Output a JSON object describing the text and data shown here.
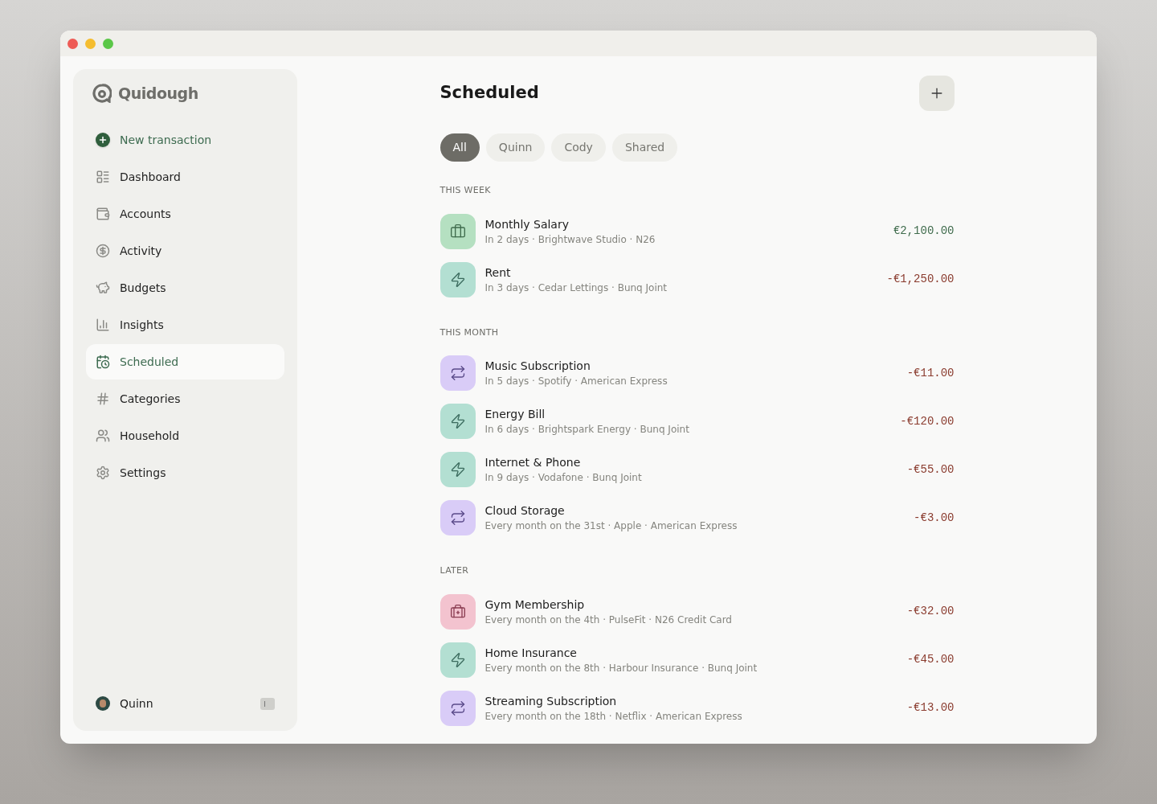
{
  "app": {
    "name": "Quidough"
  },
  "sidebar": {
    "items": [
      {
        "label": "New transaction",
        "kind": "action",
        "selected": false
      },
      {
        "label": "Dashboard",
        "kind": "dashboard",
        "selected": false
      },
      {
        "label": "Accounts",
        "kind": "wallet",
        "selected": false
      },
      {
        "label": "Activity",
        "kind": "coin",
        "selected": false
      },
      {
        "label": "Budgets",
        "kind": "piggy",
        "selected": false
      },
      {
        "label": "Insights",
        "kind": "chart",
        "selected": false
      },
      {
        "label": "Scheduled",
        "kind": "calendar",
        "selected": true
      },
      {
        "label": "Categories",
        "kind": "hash",
        "selected": false
      },
      {
        "label": "Household",
        "kind": "people",
        "selected": false
      },
      {
        "label": "Settings",
        "kind": "gear",
        "selected": false
      }
    ],
    "user": {
      "name": "Quinn"
    }
  },
  "page": {
    "title": "Scheduled"
  },
  "filters": [
    {
      "label": "All",
      "selected": true
    },
    {
      "label": "Quinn",
      "selected": false
    },
    {
      "label": "Cody",
      "selected": false
    },
    {
      "label": "Shared",
      "selected": false
    }
  ],
  "sections": [
    {
      "title": "THIS WEEK",
      "items": [
        {
          "name": "Monthly Salary",
          "detail": "In 2 days · Brightwave Studio · N26",
          "amount": "€2,100.00",
          "income": true,
          "kind": "briefcase",
          "color": "#b5e0c1"
        },
        {
          "name": "Rent",
          "detail": "In 3 days · Cedar Lettings · Bunq Joint",
          "amount": "-€1,250.00",
          "income": false,
          "kind": "bolt",
          "color": "#b3dfd2"
        }
      ]
    },
    {
      "title": "THIS MONTH",
      "items": [
        {
          "name": "Music Subscription",
          "detail": "In 5 days · Spotify · American Express",
          "amount": "-€11.00",
          "income": false,
          "kind": "repeat",
          "color": "#d9ccf7"
        },
        {
          "name": "Energy Bill",
          "detail": "In 6 days · Brightspark Energy · Bunq Joint",
          "amount": "-€120.00",
          "income": false,
          "kind": "bolt",
          "color": "#b3dfd2"
        },
        {
          "name": "Internet & Phone",
          "detail": "In 9 days · Vodafone · Bunq Joint",
          "amount": "-€55.00",
          "income": false,
          "kind": "bolt",
          "color": "#b3dfd2"
        },
        {
          "name": "Cloud Storage",
          "detail": "Every month on the 31st · Apple · American Express",
          "amount": "-€3.00",
          "income": false,
          "kind": "repeat",
          "color": "#d9ccf7"
        }
      ]
    },
    {
      "title": "LATER",
      "items": [
        {
          "name": "Gym Membership",
          "detail": "Every month on the 4th · PulseFit · N26 Credit Card",
          "amount": "-€32.00",
          "income": false,
          "kind": "medkit",
          "color": "#f3c3cf"
        },
        {
          "name": "Home Insurance",
          "detail": "Every month on the 8th · Harbour Insurance · Bunq Joint",
          "amount": "-€45.00",
          "income": false,
          "kind": "bolt",
          "color": "#b3dfd2"
        },
        {
          "name": "Streaming Subscription",
          "detail": "Every month on the 18th · Netflix · American Express",
          "amount": "-€13.00",
          "income": false,
          "kind": "repeat",
          "color": "#d9ccf7"
        }
      ]
    }
  ]
}
